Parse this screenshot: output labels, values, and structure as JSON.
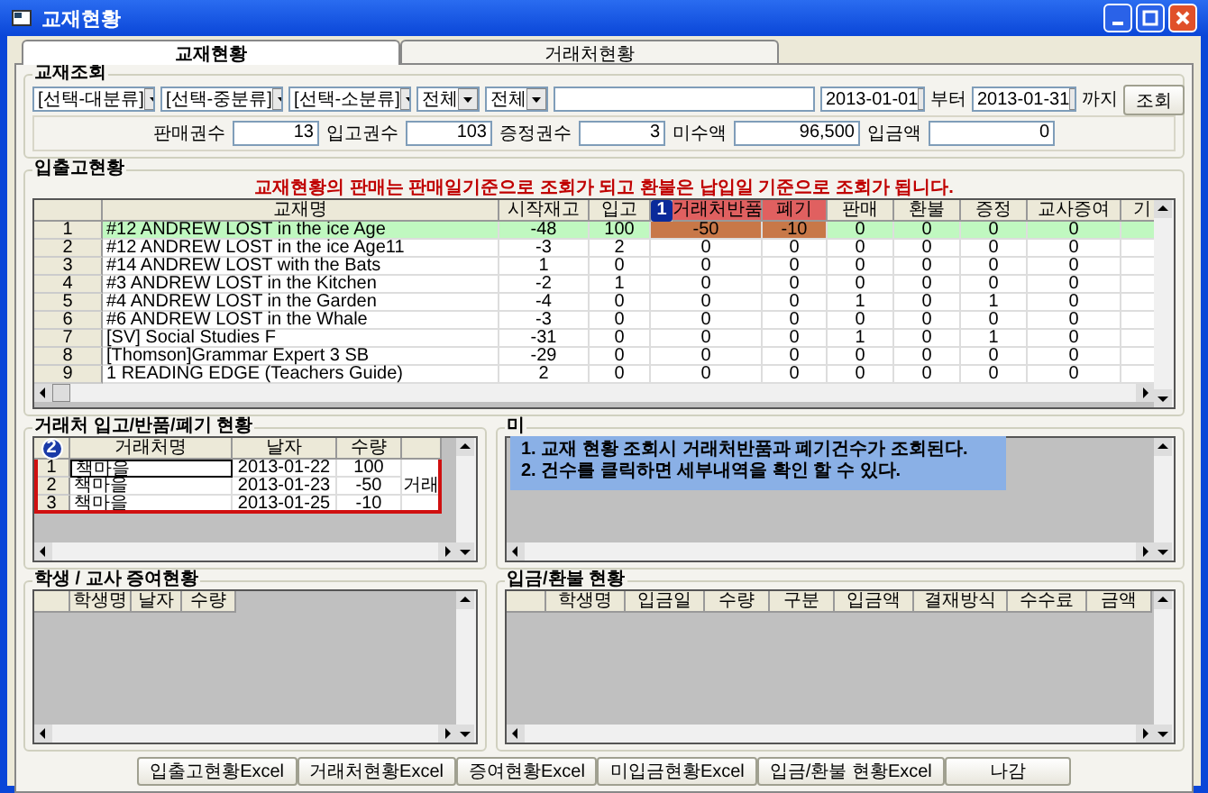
{
  "window": {
    "title": "교재현황"
  },
  "tabs": [
    {
      "label": "교재현황",
      "selected": true
    },
    {
      "label": "거래처현황",
      "selected": false
    }
  ],
  "query": {
    "title": "교재조회",
    "dropdowns": [
      "[선택-대분류]",
      "[선택-중분류]",
      "[선택-소분류]",
      "전체",
      "전체"
    ],
    "date_from": "2013-01-01",
    "from_label": "부터",
    "date_to": "2013-01-31",
    "to_label": "까지",
    "button": "조회"
  },
  "summary": [
    {
      "label": "판매권수",
      "value": "13"
    },
    {
      "label": "입고권수",
      "value": "103"
    },
    {
      "label": "증정권수",
      "value": "3"
    },
    {
      "label": "미수액",
      "value": "96,500"
    },
    {
      "label": "입금액",
      "value": "0"
    }
  ],
  "stock": {
    "title": "입출고현황",
    "notice": "교재현황의 판매는 판매일기준으로 조회가 되고 환불은 납입일 기준으로 조회가 됩니다.",
    "columns": [
      {
        "label": "교재명",
        "highlighted": false
      },
      {
        "label": "시작재고",
        "highlighted": false
      },
      {
        "label": "입고",
        "highlighted": false
      },
      {
        "label": "거래처반품",
        "highlighted": true,
        "marker": "1"
      },
      {
        "label": "폐기",
        "highlighted": true
      },
      {
        "label": "판매",
        "highlighted": false
      },
      {
        "label": "환불",
        "highlighted": false
      },
      {
        "label": "증정",
        "highlighted": false
      },
      {
        "label": "교사증여",
        "highlighted": false
      },
      {
        "label": "기",
        "highlighted": false
      }
    ],
    "rows": [
      {
        "no": "1",
        "selected": true,
        "cells": [
          "#12 ANDREW LOST in the ice Age",
          "-48",
          "100",
          "-50",
          "-10",
          "0",
          "0",
          "0",
          "0"
        ]
      },
      {
        "no": "2",
        "selected": false,
        "cells": [
          "#12 ANDREW LOST in the ice Age11",
          "-3",
          "2",
          "0",
          "0",
          "0",
          "0",
          "0",
          "0"
        ]
      },
      {
        "no": "3",
        "selected": false,
        "cells": [
          "#14 ANDREW LOST with the Bats",
          "1",
          "0",
          "0",
          "0",
          "0",
          "0",
          "0",
          "0"
        ]
      },
      {
        "no": "4",
        "selected": false,
        "cells": [
          "#3 ANDREW LOST in the Kitchen",
          "-2",
          "1",
          "0",
          "0",
          "0",
          "0",
          "0",
          "0"
        ]
      },
      {
        "no": "5",
        "selected": false,
        "cells": [
          "#4 ANDREW LOST in the Garden",
          "-4",
          "0",
          "0",
          "0",
          "1",
          "0",
          "1",
          "0"
        ]
      },
      {
        "no": "6",
        "selected": false,
        "cells": [
          "#6 ANDREW LOST in the Whale",
          "-3",
          "0",
          "0",
          "0",
          "0",
          "0",
          "0",
          "0"
        ]
      },
      {
        "no": "7",
        "selected": false,
        "cells": [
          "[SV] Social Studies F",
          "-31",
          "0",
          "0",
          "0",
          "1",
          "0",
          "1",
          "0"
        ]
      },
      {
        "no": "8",
        "selected": false,
        "cells": [
          "[Thomson]Grammar Expert 3 SB",
          "-29",
          "0",
          "0",
          "0",
          "0",
          "0",
          "0",
          "0"
        ]
      },
      {
        "no": "9",
        "selected": false,
        "cells": [
          "1 READING EDGE  (Teachers Guide)",
          "2",
          "0",
          "0",
          "0",
          "0",
          "0",
          "0",
          "0"
        ]
      }
    ]
  },
  "vendor": {
    "title": "거래처 입고/반품/폐기 현황",
    "marker": "2",
    "columns": [
      "거래처명",
      "날자",
      "수량"
    ],
    "rows": [
      {
        "no": "1",
        "selected": true,
        "cells": [
          "책마을",
          "2013-01-22",
          "100"
        ]
      },
      {
        "no": "2",
        "selected": false,
        "cells": [
          "책마을",
          "2013-01-23",
          "-50",
          "거래"
        ]
      },
      {
        "no": "3",
        "selected": false,
        "cells": [
          "책마을",
          "2013-01-25",
          "-10"
        ]
      }
    ]
  },
  "unpaid": {
    "title": "미"
  },
  "callout": [
    "1. 교재 현황 조회시 거래처반품과 폐기건수가 조회된다.",
    "2. 건수를 클릭하면 세부내역을 확인 할 수 있다."
  ],
  "gifts": {
    "title": "학생 / 교사 증여현황",
    "columns": [
      "학생명",
      "날자",
      "수량"
    ]
  },
  "payments": {
    "title": "입금/환불 현황",
    "columns": [
      "학생명",
      "입금일",
      "수량",
      "구분",
      "입금액",
      "결재방식",
      "수수료",
      "금액"
    ]
  },
  "buttons": [
    "입출고현황Excel",
    "거래처현황Excel",
    "증여현황Excel",
    "미입금현황Excel",
    "입금/환불 현황Excel",
    "나감"
  ]
}
